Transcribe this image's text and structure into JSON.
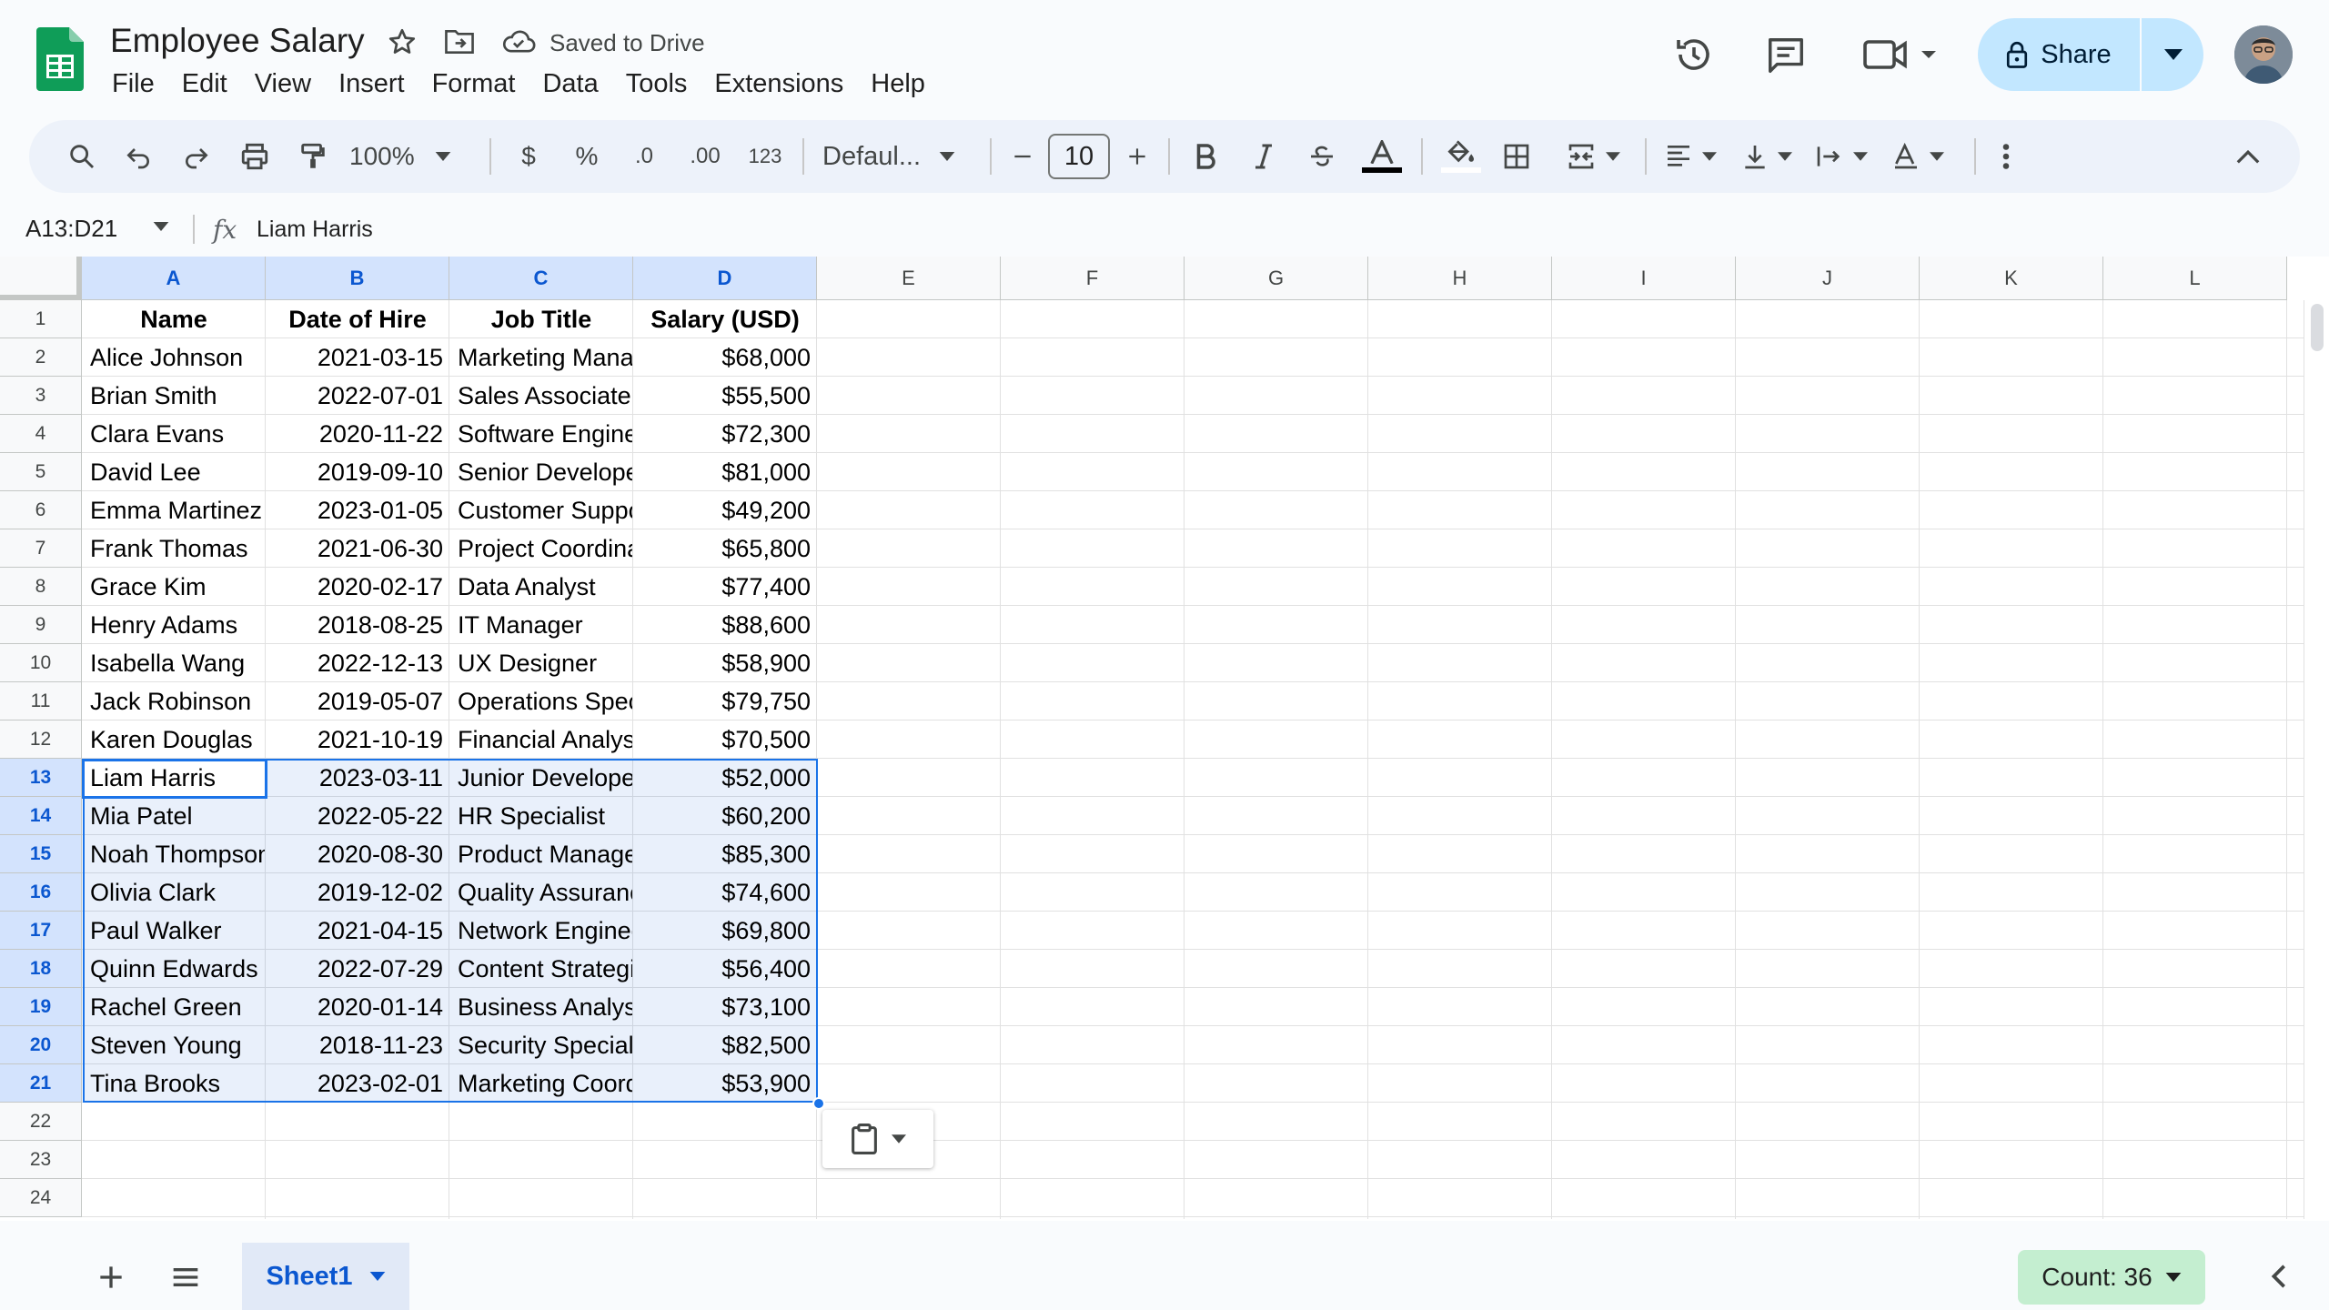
{
  "app": {
    "doc_title": "Employee Salary",
    "save_status": "Saved to Drive",
    "menu": [
      "File",
      "Edit",
      "View",
      "Insert",
      "Format",
      "Data",
      "Tools",
      "Extensions",
      "Help"
    ],
    "share_label": "Share"
  },
  "toolbar": {
    "zoom": "100%",
    "currency": "$",
    "percent": "%",
    "dec_decrease": ".0",
    "dec_increase": ".00",
    "number_format": "123",
    "font": "Defaul...",
    "font_size": "10"
  },
  "formula_bar": {
    "name_box": "A13:D21",
    "fx": "fx",
    "content": "Liam Harris"
  },
  "columns": [
    "A",
    "B",
    "C",
    "D",
    "E",
    "F",
    "G",
    "H",
    "I",
    "J",
    "K",
    "L"
  ],
  "rows": [
    "1",
    "2",
    "3",
    "4",
    "5",
    "6",
    "7",
    "8",
    "9",
    "10",
    "11",
    "12",
    "13",
    "14",
    "15",
    "16",
    "17",
    "18",
    "19",
    "20",
    "21",
    "22",
    "23",
    "24"
  ],
  "table": {
    "headers": [
      "Name",
      "Date of Hire",
      "Job Title",
      "Salary (USD)"
    ],
    "rows": [
      [
        "Alice Johnson",
        "2021-03-15",
        "Marketing Mana",
        "$68,000"
      ],
      [
        "Brian Smith",
        "2022-07-01",
        "Sales Associate",
        "$55,500"
      ],
      [
        "Clara Evans",
        "2020-11-22",
        "Software Engine",
        "$72,300"
      ],
      [
        "David Lee",
        "2019-09-10",
        "Senior Develope",
        "$81,000"
      ],
      [
        "Emma Martinez",
        "2023-01-05",
        "Customer Suppo",
        "$49,200"
      ],
      [
        "Frank Thomas",
        "2021-06-30",
        "Project Coordina",
        "$65,800"
      ],
      [
        "Grace Kim",
        "2020-02-17",
        "Data Analyst",
        "$77,400"
      ],
      [
        "Henry Adams",
        "2018-08-25",
        "IT Manager",
        "$88,600"
      ],
      [
        "Isabella Wang",
        "2022-12-13",
        "UX Designer",
        "$58,900"
      ],
      [
        "Jack Robinson",
        "2019-05-07",
        "Operations Spec",
        "$79,750"
      ],
      [
        "Karen Douglas",
        "2021-10-19",
        "Financial Analys",
        "$70,500"
      ],
      [
        "Liam Harris",
        "2023-03-11",
        "Junior Develope",
        "$52,000"
      ],
      [
        "Mia Patel",
        "2022-05-22",
        "HR Specialist",
        "$60,200"
      ],
      [
        "Noah Thompson",
        "2020-08-30",
        "Product Manage",
        "$85,300"
      ],
      [
        "Olivia Clark",
        "2019-12-02",
        "Quality Assuranc",
        "$74,600"
      ],
      [
        "Paul Walker",
        "2021-04-15",
        "Network Enginee",
        "$69,800"
      ],
      [
        "Quinn Edwards",
        "2022-07-29",
        "Content Strategi",
        "$56,400"
      ],
      [
        "Rachel Green",
        "2020-01-14",
        "Business Analys",
        "$73,100"
      ],
      [
        "Steven Young",
        "2018-11-23",
        "Security Speciali",
        "$82,500"
      ],
      [
        "Tina Brooks",
        "2023-02-01",
        "Marketing Coord",
        "$53,900"
      ]
    ]
  },
  "selection": {
    "range": "A13:D21",
    "active_cell": "A13"
  },
  "sheet_tabs": [
    {
      "label": "Sheet1",
      "active": true
    }
  ],
  "status": {
    "count_label": "Count: 36"
  },
  "colors": {
    "accent": "#0b57d0",
    "share_bg": "#c2e7ff",
    "selection_border": "#1a73e8",
    "count_chip_bg": "#c4eed0",
    "logo_green": "#0f9d58"
  },
  "icons": [
    "search-icon",
    "undo-icon",
    "redo-icon",
    "print-icon",
    "paint-format-icon",
    "bold-icon",
    "italic-icon",
    "strikethrough-icon",
    "text-color-icon",
    "fill-color-icon",
    "borders-icon",
    "merge-cells-icon",
    "align-icon",
    "valign-icon",
    "text-wrap-icon",
    "text-rotate-icon",
    "more-icon",
    "collapse-icon",
    "history-icon",
    "comment-icon",
    "meet-icon",
    "lock-icon",
    "star-icon",
    "move-folder-icon",
    "cloud-icon",
    "paste-icon"
  ]
}
